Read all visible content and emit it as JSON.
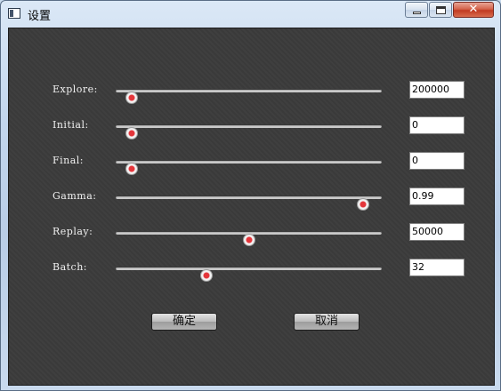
{
  "window": {
    "title": "设置",
    "controls": {
      "minimize_icon": "minimize-icon",
      "maximize_icon": "maximize-icon",
      "close_icon": "close-icon",
      "close_glyph": "✕"
    }
  },
  "settings": {
    "rows": [
      {
        "label": "Explore:",
        "value": "200000",
        "slider_fraction": 0.06
      },
      {
        "label": "Initial:",
        "value": "0",
        "slider_fraction": 0.06
      },
      {
        "label": "Final:",
        "value": "0",
        "slider_fraction": 0.06
      },
      {
        "label": "Gamma:",
        "value": "0.99",
        "slider_fraction": 0.93
      },
      {
        "label": "Replay:",
        "value": "50000",
        "slider_fraction": 0.5
      },
      {
        "label": "Batch:",
        "value": "32",
        "slider_fraction": 0.34
      }
    ]
  },
  "buttons": {
    "ok_label": "确定",
    "cancel_label": "取消"
  },
  "colors": {
    "panel": "#3d3d3d",
    "thumb_center": "#e4353a",
    "track": "#c9c9c9"
  }
}
